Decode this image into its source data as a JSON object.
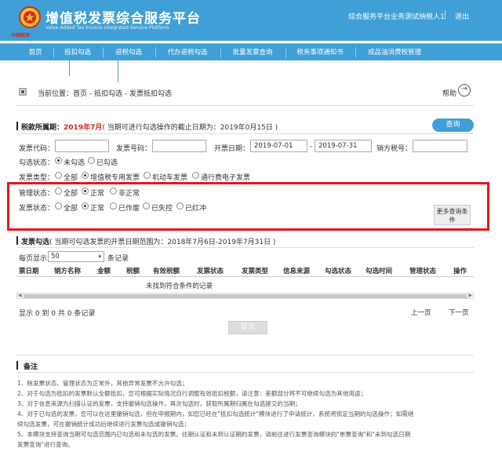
{
  "header": {
    "logo_text": "中国税务",
    "title": "增值税发票综合服务平台",
    "subtitle": "Value Added Tax Invoice Integrated Service Platform",
    "user": "综合服务平台业务测试纳税人1",
    "logout": "退出"
  },
  "nav": [
    "首页",
    "抵扣勾选",
    "退税勾选",
    "代办退税勾选",
    "批量发票查询",
    "税务事项通知书",
    "成品油消费税管理"
  ],
  "breadcrumb": "当前位置：首页 - 抵扣勾选 - 发票抵扣勾选",
  "help": "帮助",
  "period": {
    "label": "税款所属期：",
    "value": "2019年7月",
    "note": "( 当期可进行勾选操作的截止日期为：2019年0月15日 )"
  },
  "query_button": "查询",
  "form": {
    "code_label": "发票代码：",
    "number_label": "发票号码：",
    "date_label": "开票日期：",
    "date_from": "2019-07-01",
    "date_sep": "-",
    "date_to": "2019-07-31",
    "seller_label": "销方税号：",
    "check_label": "勾选状态：",
    "check_opts": [
      "未勾选",
      "已勾选"
    ],
    "type_label": "发票类型：",
    "type_opts": [
      "全部",
      "增值税专用发票",
      "机动车发票",
      "通行费电子发票"
    ],
    "mgmt_label": "管理状态：",
    "mgmt_opts": [
      "全部",
      "正常",
      "非正常"
    ],
    "status_label": "发票状态：",
    "status_opts": [
      "全部",
      "正常",
      "已作废",
      "已失控",
      "已红冲"
    ],
    "more": "更多查询条件"
  },
  "invoice": {
    "label": "发票勾选",
    "note": "( 当期可勾选发票的开票日期范围为：2018年7月6日-2019年7月31日 )",
    "per_page_label": "每页显示",
    "per_page": "50",
    "records": "条记录",
    "columns": [
      "票日期",
      "销方名称",
      "金额",
      "税额",
      "有效税额",
      "发票状态",
      "发票类型",
      "信息来源",
      "勾选状态",
      "勾选时间",
      "管理状态",
      "操作"
    ],
    "empty": "未找到符合条件的记录",
    "summary": "显示 0 到 0 共 0 条记录",
    "prev": "上一页",
    "next": "下一页",
    "submit": "提交"
  },
  "remarks": {
    "title": "备注",
    "lines": [
      "1、除发票状态、管理状态为正常外，其他异常发票不允许勾选；",
      "2、对于勾选为抵扣的发票默认全额抵扣，您可根据实际情况自行调整有效抵扣税额，请注意：差额部分将不可继续勾选为其他用途；",
      "3、对于信息来源为扫描认证的发票，支持撤销勾选操作，再次勾选时，获取所属期归属在勾选提交的当期；",
      "4、对于已勾选的发票，您可以在这里撤销勾选，但在申报期内，如您已经在\"抵扣勾选统计\"模块进行了申请统计，系统将锁定当期的勾选操作；如需继",
      "续勾选发票，可在撤销统计成功后继续进行发票勾选或撤销勾选；",
      "5、本模块支持查询当期可勾选范围内已勾选和未勾选的发票。往期认证和未到认证期的发票，请前往进行发票查询模块的\"单票查询\"和\"未到勾选日期",
      "发票查询\"进行查询。"
    ]
  },
  "colors": {
    "primary": "#3f9fd6",
    "accent_red": "#d8261e",
    "highlight_box": "#e3161c"
  }
}
